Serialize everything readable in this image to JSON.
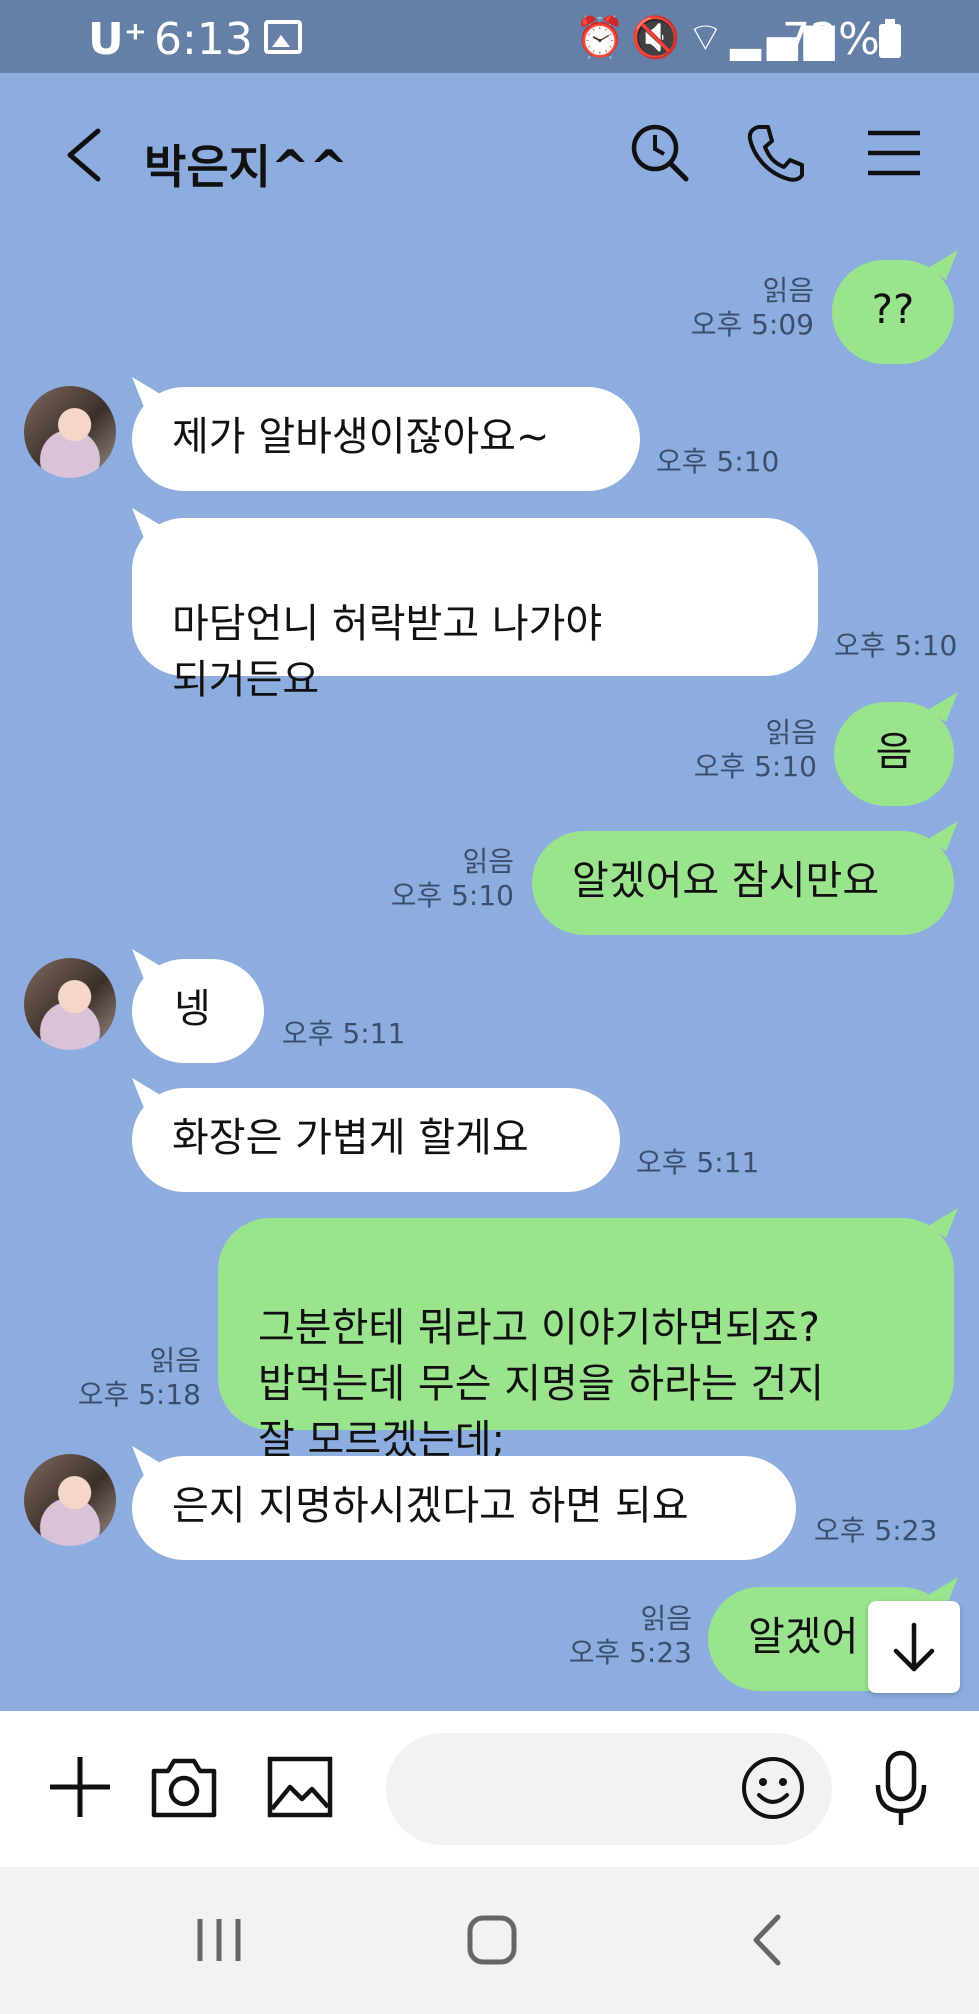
{
  "status_bar": {
    "carrier": "U⁺",
    "time": "6:13",
    "battery": "72%",
    "icons": [
      "alarm-icon",
      "mute-icon",
      "wifi-icon",
      "signal-icon",
      "battery-icon",
      "gallery-icon"
    ]
  },
  "header": {
    "title": "박은지^^",
    "icons": [
      "back-icon",
      "search-icon",
      "phone-icon",
      "menu-icon"
    ]
  },
  "messages": [
    {
      "dir": "out",
      "text": "??",
      "read": "읽음",
      "time": "오후 5:09"
    },
    {
      "dir": "in",
      "text": "제가 알바생이잖아요~",
      "time": "오후 5:10",
      "avatar": true
    },
    {
      "dir": "in",
      "text": "마담언니 허락받고 나가야\n되거든요",
      "time": "오후 5:10"
    },
    {
      "dir": "out",
      "text": "음",
      "read": "읽음",
      "time": "오후 5:10"
    },
    {
      "dir": "out",
      "text": "알겠어요 잠시만요",
      "read": "읽음",
      "time": "오후 5:10"
    },
    {
      "dir": "in",
      "text": "넹",
      "time": "오후 5:11",
      "avatar": true
    },
    {
      "dir": "in",
      "text": "화장은 가볍게 할게요",
      "time": "오후 5:11"
    },
    {
      "dir": "out",
      "text": "그분한테 뭐라고 이야기하면되죠?\n밥먹는데 무슨 지명을 하라는 건지\n잘 모르겠는데;",
      "read": "읽음",
      "time": "오후 5:18"
    },
    {
      "dir": "in",
      "text": "은지 지명하시겠다고 하면 되요",
      "time": "오후 5:23",
      "avatar": true
    },
    {
      "dir": "out",
      "text": "알겠어",
      "read": "읽음",
      "time": "오후 5:23"
    }
  ],
  "input": {
    "placeholder": ""
  },
  "input_icons": [
    "plus-icon",
    "camera-icon",
    "image-icon",
    "emoji-icon",
    "mic-icon"
  ],
  "nav_icons": [
    "recents-icon",
    "home-icon",
    "back-nav-icon"
  ],
  "colors": {
    "background": "#8eaddf",
    "status_bar": "#667fa6",
    "outgoing_bubble": "#9be48e",
    "incoming_bubble": "#ffffff"
  }
}
